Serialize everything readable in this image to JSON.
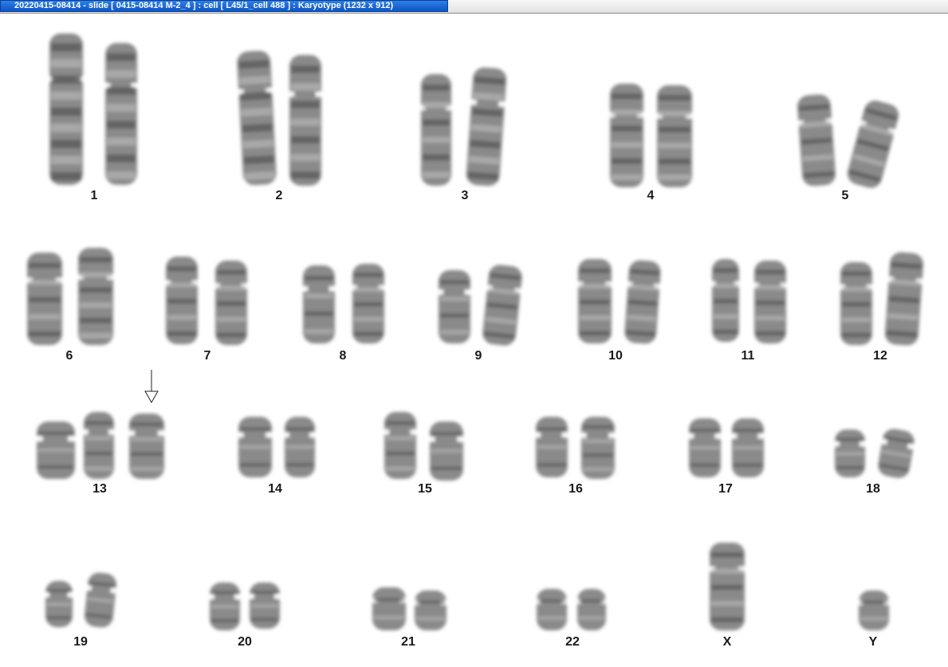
{
  "window": {
    "title": "20220415-08414 - slide [ 0415-08414 M-2_4 ] : cell [ L45/1_cell 488 ] : Karyotype  (1232 x 912)"
  },
  "karyotype": {
    "labels": {
      "c1": "1",
      "c2": "2",
      "c3": "3",
      "c4": "4",
      "c5": "5",
      "c6": "6",
      "c7": "7",
      "c8": "8",
      "c9": "9",
      "c10": "10",
      "c11": "11",
      "c12": "12",
      "c13": "13",
      "c14": "14",
      "c15": "15",
      "c16": "16",
      "c17": "17",
      "c18": "18",
      "c19": "19",
      "c20": "20",
      "c21": "21",
      "c22": "22",
      "cX": "X",
      "cY": "Y"
    },
    "annotation": {
      "arrow_target": "13"
    }
  }
}
